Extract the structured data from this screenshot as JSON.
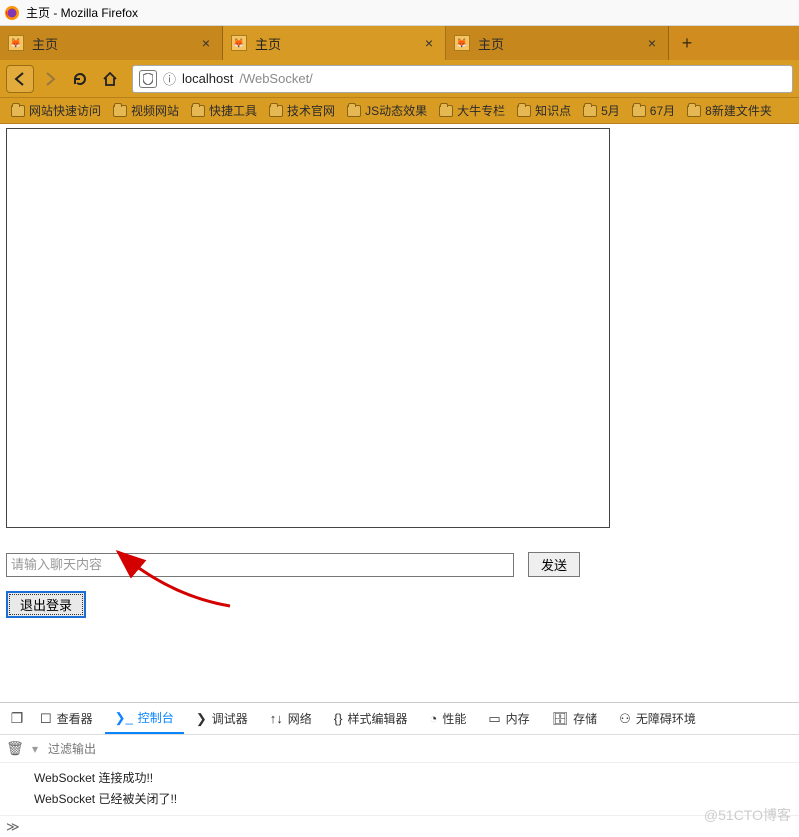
{
  "window": {
    "title": "主页 - Mozilla Firefox"
  },
  "tabs": {
    "items": [
      {
        "title": "主页",
        "active": false
      },
      {
        "title": "主页",
        "active": true
      },
      {
        "title": "主页",
        "active": false
      }
    ]
  },
  "url": {
    "host": "localhost",
    "path": "/WebSocket/"
  },
  "bookmarks": {
    "items": [
      {
        "label": "网站快速访问"
      },
      {
        "label": "视频网站"
      },
      {
        "label": "快捷工具"
      },
      {
        "label": "技术官网"
      },
      {
        "label": "JS动态效果"
      },
      {
        "label": "大牛专栏"
      },
      {
        "label": "知识点"
      },
      {
        "label": "5月"
      },
      {
        "label": "67月"
      },
      {
        "label": "8新建文件夹"
      }
    ]
  },
  "page": {
    "chat_placeholder": "请输入聊天内容",
    "send_label": "发送",
    "logout_label": "退出登录"
  },
  "devtools": {
    "tabs": {
      "inspector": "查看器",
      "console": "控制台",
      "debugger": "调试器",
      "network": "网络",
      "style": "样式编辑器",
      "perf": "性能",
      "memory": "内存",
      "storage": "存储",
      "a11y": "无障碍环境"
    },
    "filter_placeholder": "过滤输出",
    "console_lines": [
      "WebSocket 连接成功!!",
      "WebSocket 已经被关闭了!!"
    ]
  },
  "watermark": "@51CTO博客"
}
